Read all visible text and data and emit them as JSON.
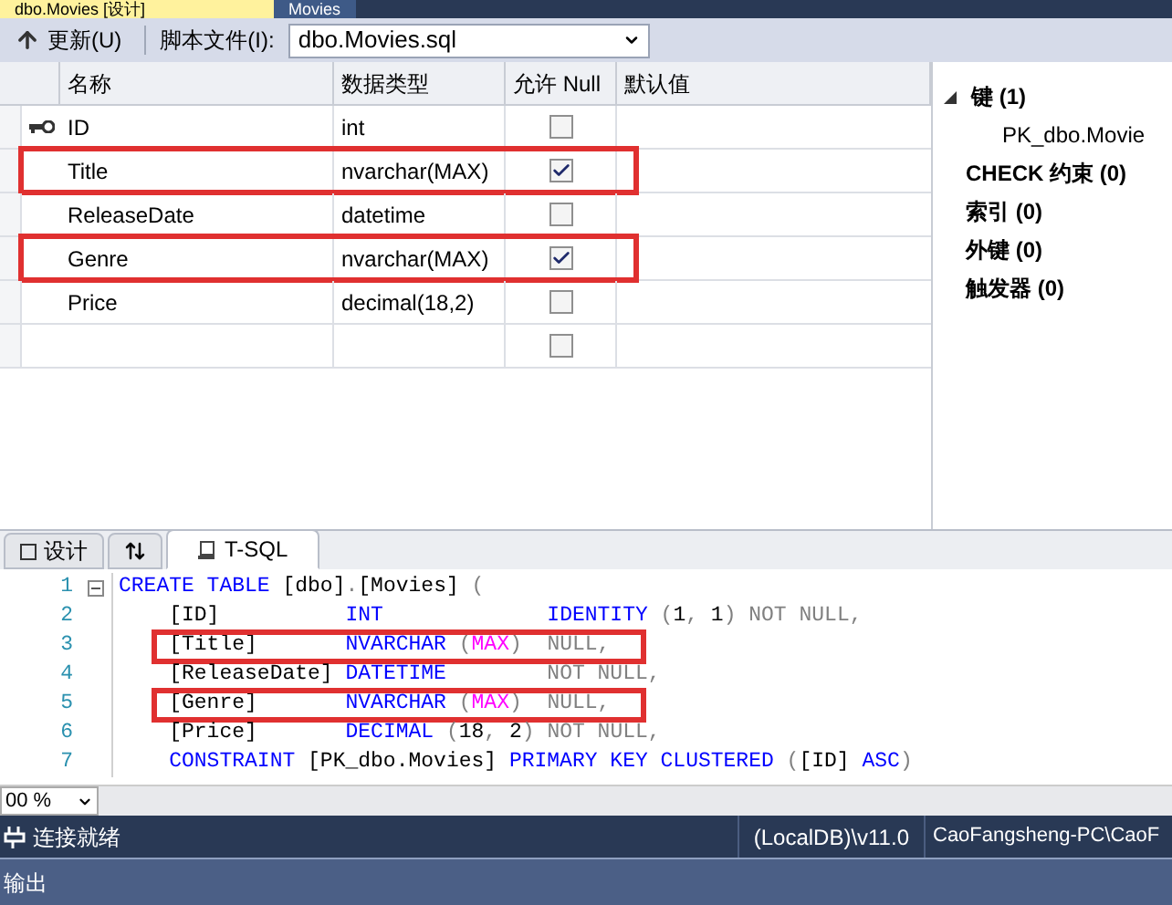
{
  "document_tabs": [
    {
      "label": "dbo.Movies [设计]",
      "selected": true
    },
    {
      "label": "Movies",
      "selected": false
    }
  ],
  "toolbar": {
    "update_button": "更新(U)",
    "script_file_label": "脚本文件(I):",
    "script_file": "dbo.Movies.sql"
  },
  "grid": {
    "columns": [
      "名称",
      "数据类型",
      "允许 Null",
      "默认值"
    ],
    "rows": [
      {
        "name": "ID",
        "type": "int",
        "allow_null": false,
        "primary_key": true,
        "highlighted": false
      },
      {
        "name": "Title",
        "type": "nvarchar(MAX)",
        "allow_null": true,
        "primary_key": false,
        "highlighted": true
      },
      {
        "name": "ReleaseDate",
        "type": "datetime",
        "allow_null": false,
        "primary_key": false,
        "highlighted": false
      },
      {
        "name": "Genre",
        "type": "nvarchar(MAX)",
        "allow_null": true,
        "primary_key": false,
        "highlighted": true
      },
      {
        "name": "Price",
        "type": "decimal(18,2)",
        "allow_null": false,
        "primary_key": false,
        "highlighted": false
      },
      {
        "allow_null": false,
        "primary_key": false,
        "highlighted": false
      }
    ]
  },
  "keys_panel": {
    "items": [
      {
        "label": "键 (1)",
        "expanded": true,
        "children": [
          {
            "label": "PK_dbo.Movie"
          }
        ]
      },
      {
        "label": "CHECK 约束 (0)"
      },
      {
        "label": "索引 (0)"
      },
      {
        "label": "外键 (0)"
      },
      {
        "label": "触发器 (0)"
      }
    ]
  },
  "view_tabs": [
    {
      "label": "设计",
      "kind": "design",
      "selected": false
    },
    {
      "kind": "swap",
      "selected": false
    },
    {
      "label": "T-SQL",
      "kind": "tsql",
      "selected": true
    }
  ],
  "code": {
    "lines": [
      {
        "number": "1",
        "foldable": true,
        "highlighted": false,
        "tokens": [
          {
            "text": "CREATE TABLE",
            "kind": "keyword"
          },
          {
            "text": " [dbo]",
            "kind": "plain"
          },
          {
            "text": ".",
            "kind": "punct"
          },
          {
            "text": "[Movies]",
            "kind": "plain"
          },
          {
            "text": " (",
            "kind": "punct"
          }
        ]
      },
      {
        "number": "2",
        "foldable": false,
        "highlighted": false,
        "tokens": [
          {
            "text": "    [ID]          ",
            "kind": "plain"
          },
          {
            "text": "INT",
            "kind": "keyword"
          },
          {
            "text": "             IDENTITY",
            "kind": "keyword"
          },
          {
            "text": " (",
            "kind": "punct"
          },
          {
            "text": "1",
            "kind": "plain"
          },
          {
            "text": ", ",
            "kind": "punct"
          },
          {
            "text": "1",
            "kind": "plain"
          },
          {
            "text": ") NOT NULL,",
            "kind": "punct"
          }
        ]
      },
      {
        "number": "3",
        "foldable": false,
        "highlighted": true,
        "tokens": [
          {
            "text": "    [Title]       ",
            "kind": "plain"
          },
          {
            "text": "NVARCHAR",
            "kind": "keyword"
          },
          {
            "text": " (",
            "kind": "punct"
          },
          {
            "text": "MAX",
            "kind": "function"
          },
          {
            "text": ")  NULL,",
            "kind": "punct"
          }
        ]
      },
      {
        "number": "4",
        "foldable": false,
        "highlighted": false,
        "tokens": [
          {
            "text": "    [ReleaseDate] ",
            "kind": "plain"
          },
          {
            "text": "DATETIME",
            "kind": "keyword"
          },
          {
            "text": "        NOT NULL,",
            "kind": "punct"
          }
        ]
      },
      {
        "number": "5",
        "foldable": false,
        "highlighted": true,
        "tokens": [
          {
            "text": "    [Genre]       ",
            "kind": "plain"
          },
          {
            "text": "NVARCHAR",
            "kind": "keyword"
          },
          {
            "text": " (",
            "kind": "punct"
          },
          {
            "text": "MAX",
            "kind": "function"
          },
          {
            "text": ")  NULL,",
            "kind": "punct"
          }
        ]
      },
      {
        "number": "6",
        "foldable": false,
        "highlighted": false,
        "tokens": [
          {
            "text": "    [Price]       ",
            "kind": "plain"
          },
          {
            "text": "DECIMAL",
            "kind": "keyword"
          },
          {
            "text": " (",
            "kind": "punct"
          },
          {
            "text": "18",
            "kind": "plain"
          },
          {
            "text": ", ",
            "kind": "punct"
          },
          {
            "text": "2",
            "kind": "plain"
          },
          {
            "text": ") NOT NULL,",
            "kind": "punct"
          }
        ]
      },
      {
        "number": "7",
        "foldable": false,
        "highlighted": false,
        "tokens": [
          {
            "text": "    CONSTRAINT",
            "kind": "keyword"
          },
          {
            "text": " [PK_dbo.Movies] ",
            "kind": "plain"
          },
          {
            "text": "PRIMARY KEY CLUSTERED",
            "kind": "keyword"
          },
          {
            "text": " (",
            "kind": "punct"
          },
          {
            "text": "[ID] ",
            "kind": "plain"
          },
          {
            "text": "ASC",
            "kind": "keyword"
          },
          {
            "text": ")",
            "kind": "punct"
          }
        ]
      }
    ]
  },
  "zoom": "00 %",
  "status_bar": {
    "status": "连接就绪",
    "server": "(LocalDB)\\v11.0",
    "user": "CaoFangsheng-PC\\CaoF"
  },
  "output_panel": {
    "title": "输出"
  }
}
